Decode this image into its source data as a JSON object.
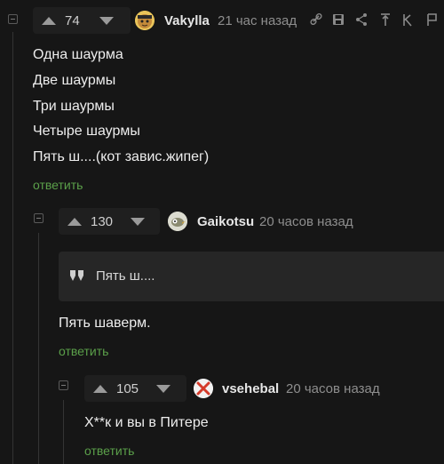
{
  "comments": [
    {
      "rating": "74",
      "username": "Vakylla",
      "time": "21 час назад",
      "lines": [
        "Одна шаурма",
        "Две шаурмы",
        "Три шаурмы",
        "Четыре шаурмы",
        "Пять ш....(кот завис.жипег)"
      ],
      "reply": "ответить",
      "avatar_icon": "pirate-cat-avatar",
      "toolbar_icons": [
        "link-icon",
        "save-icon",
        "share-icon",
        "pin-icon",
        "hide-icon"
      ]
    },
    {
      "rating": "130",
      "username": "Gaikotsu",
      "time": "20 часов назад",
      "quote": "Пять ш....",
      "text": "Пять шаверм.",
      "reply": "ответить",
      "avatar_icon": "bird-avatar"
    },
    {
      "rating": "105",
      "username": "vsehebal",
      "time": "20 часов назад",
      "text": "Х**к и вы в Питере",
      "reply": "ответить",
      "avatar_icon": "red-x-avatar"
    }
  ],
  "colors": {
    "background": "#161616",
    "reply_link": "#5ba04a",
    "quote_bg": "#262626",
    "thread_line": "#343434"
  }
}
